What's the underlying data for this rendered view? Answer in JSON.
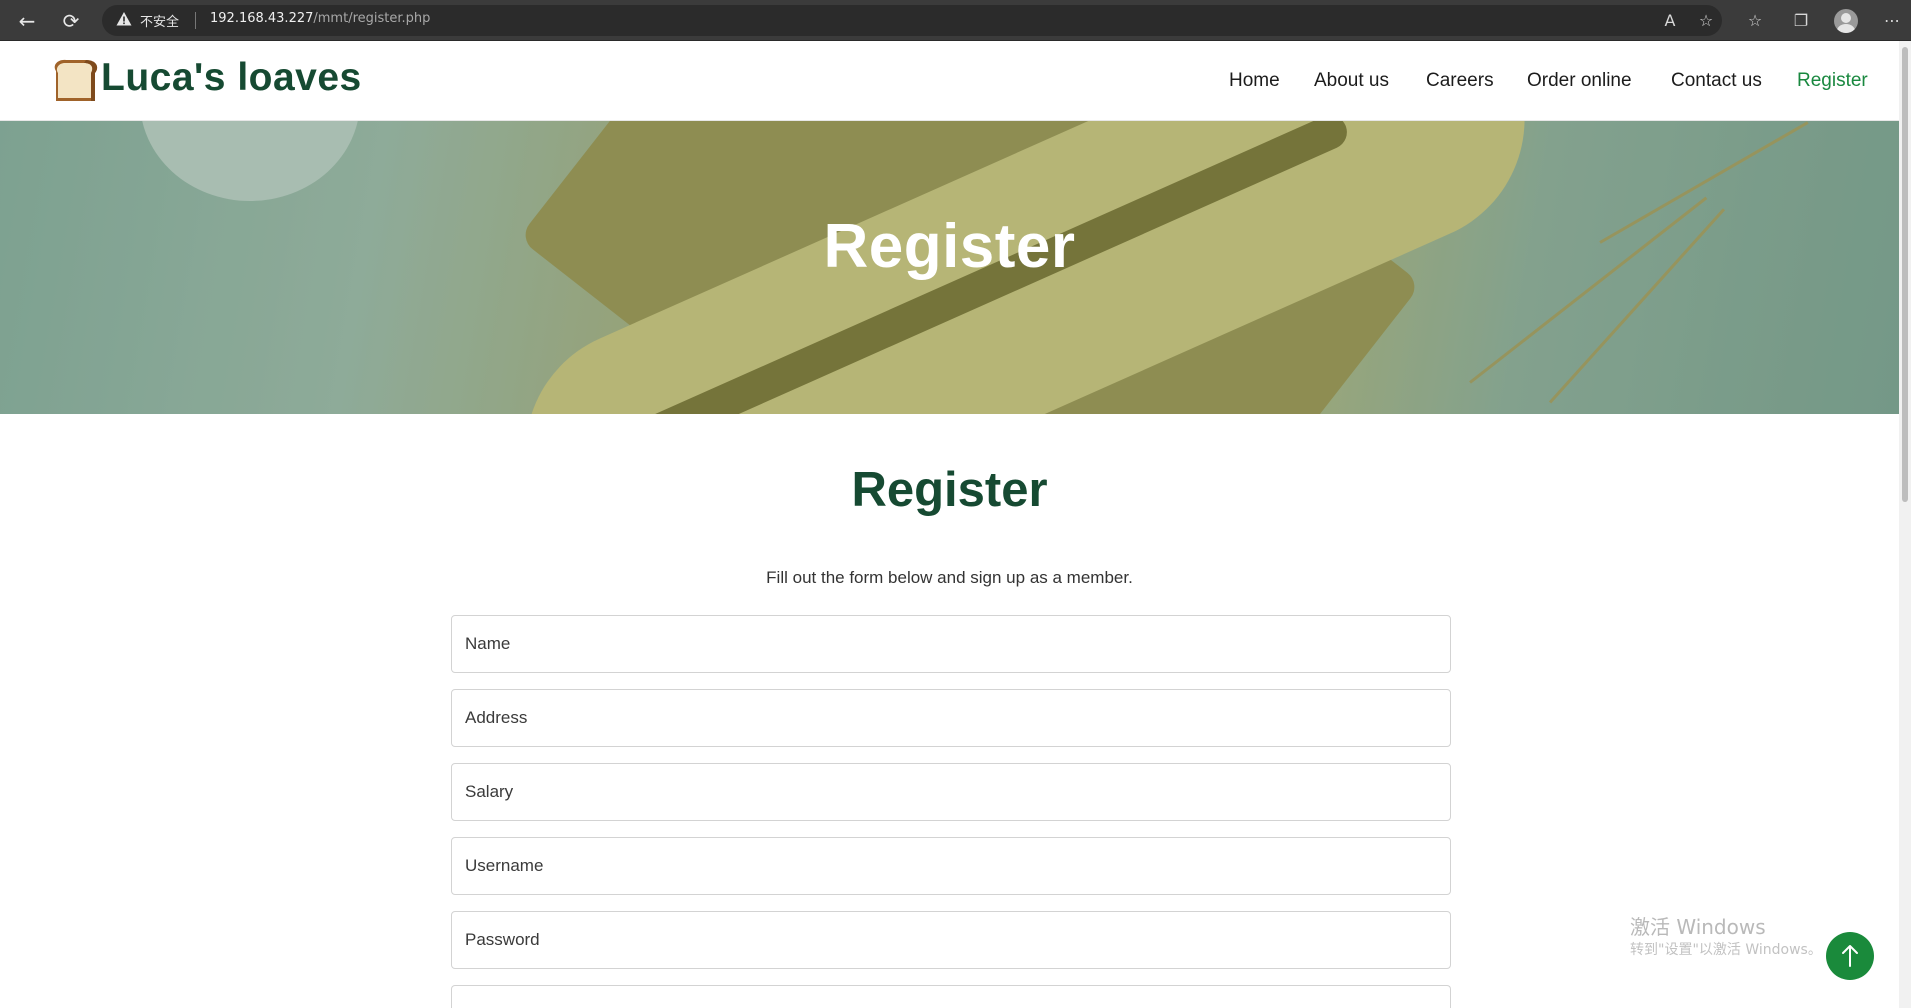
{
  "browser": {
    "security_label": "不安全",
    "url_host": "192.168.43.227",
    "url_path": "/mmt/register.php"
  },
  "site": {
    "logo_text": "Luca's loaves",
    "nav": [
      {
        "label": "Home",
        "active": false
      },
      {
        "label": "About us",
        "active": false
      },
      {
        "label": "Careers",
        "active": false
      },
      {
        "label": "Order online",
        "active": false
      },
      {
        "label": "Contact us",
        "active": false
      },
      {
        "label": "Register",
        "active": true
      }
    ],
    "active_color": "#19883f",
    "brand_color": "#164a32"
  },
  "hero": {
    "title": "Register"
  },
  "form": {
    "title": "Register",
    "subtitle": "Fill out the form below and sign up as a member.",
    "fields": [
      {
        "placeholder": "Name"
      },
      {
        "placeholder": "Address"
      },
      {
        "placeholder": "Salary"
      },
      {
        "placeholder": "Username"
      },
      {
        "placeholder": "Password"
      }
    ]
  },
  "watermark": {
    "line1": "激活 Windows",
    "line2": "转到\"设置\"以激活 Windows。"
  }
}
